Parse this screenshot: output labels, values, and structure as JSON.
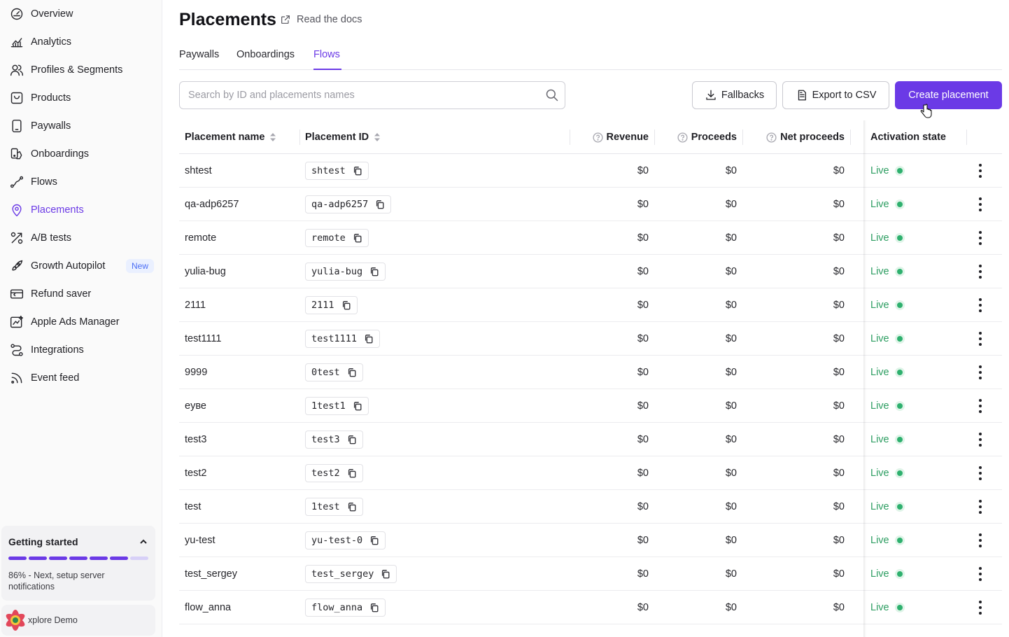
{
  "sidebar": {
    "items": [
      {
        "label": "Overview",
        "icon": "gauge-icon"
      },
      {
        "label": "Analytics",
        "icon": "chart-icon"
      },
      {
        "label": "Profiles & Segments",
        "icon": "users-icon"
      },
      {
        "label": "Products",
        "icon": "box-icon"
      },
      {
        "label": "Paywalls",
        "icon": "phone-icon"
      },
      {
        "label": "Onboardings",
        "icon": "onboarding-icon"
      },
      {
        "label": "Flows",
        "icon": "flow-icon"
      },
      {
        "label": "Placements",
        "icon": "pin-icon",
        "active": true
      },
      {
        "label": "A/B tests",
        "icon": "split-icon"
      },
      {
        "label": "Growth Autopilot",
        "icon": "rocket-icon",
        "badge": "New"
      },
      {
        "label": "Refund saver",
        "icon": "refund-icon"
      },
      {
        "label": "Apple Ads Manager",
        "icon": "ads-icon"
      },
      {
        "label": "Integrations",
        "icon": "integrations-icon"
      },
      {
        "label": "Event feed",
        "icon": "rss-icon"
      }
    ],
    "getting_started": {
      "title": "Getting started",
      "progress_segments_total": 7,
      "progress_segments_done": 6,
      "text": "86% - Next, setup server notifications"
    },
    "demo": {
      "label": "xplore Demo"
    }
  },
  "header": {
    "title": "Placements",
    "docs_link": "Read the docs"
  },
  "tabs": [
    {
      "label": "Paywalls"
    },
    {
      "label": "Onboardings"
    },
    {
      "label": "Flows",
      "active": true
    }
  ],
  "toolbar": {
    "search_placeholder": "Search by ID and placements names",
    "fallbacks_label": "Fallbacks",
    "export_label": "Export to CSV",
    "create_label": "Create placement"
  },
  "table": {
    "columns": {
      "name": "Placement name",
      "id": "Placement ID",
      "revenue": "Revenue",
      "proceeds": "Proceeds",
      "net_proceeds": "Net proceeds",
      "activation": "Activation state"
    },
    "rows": [
      {
        "name": "shtest",
        "id": "shtest",
        "revenue": "$0",
        "proceeds": "$0",
        "net": "$0",
        "state": "Live"
      },
      {
        "name": "qa-adp6257",
        "id": "qa-adp6257",
        "revenue": "$0",
        "proceeds": "$0",
        "net": "$0",
        "state": "Live"
      },
      {
        "name": "remote",
        "id": "remote",
        "revenue": "$0",
        "proceeds": "$0",
        "net": "$0",
        "state": "Live"
      },
      {
        "name": "yulia-bug",
        "id": "yulia-bug",
        "revenue": "$0",
        "proceeds": "$0",
        "net": "$0",
        "state": "Live"
      },
      {
        "name": "2111",
        "id": "2111",
        "revenue": "$0",
        "proceeds": "$0",
        "net": "$0",
        "state": "Live"
      },
      {
        "name": "test1111",
        "id": "test1111",
        "revenue": "$0",
        "proceeds": "$0",
        "net": "$0",
        "state": "Live"
      },
      {
        "name": "9999",
        "id": "0test",
        "revenue": "$0",
        "proceeds": "$0",
        "net": "$0",
        "state": "Live"
      },
      {
        "name": "eyве",
        "id": "1test1",
        "revenue": "$0",
        "proceeds": "$0",
        "net": "$0",
        "state": "Live"
      },
      {
        "name": "test3",
        "id": "test3",
        "revenue": "$0",
        "proceeds": "$0",
        "net": "$0",
        "state": "Live"
      },
      {
        "name": "test2",
        "id": "test2",
        "revenue": "$0",
        "proceeds": "$0",
        "net": "$0",
        "state": "Live"
      },
      {
        "name": "test",
        "id": "1test",
        "revenue": "$0",
        "proceeds": "$0",
        "net": "$0",
        "state": "Live"
      },
      {
        "name": "yu-test",
        "id": "yu-test-0",
        "revenue": "$0",
        "proceeds": "$0",
        "net": "$0",
        "state": "Live"
      },
      {
        "name": "test_sergey",
        "id": "test_sergey",
        "revenue": "$0",
        "proceeds": "$0",
        "net": "$0",
        "state": "Live"
      },
      {
        "name": "flow_anna",
        "id": "flow_anna",
        "revenue": "$0",
        "proceeds": "$0",
        "net": "$0",
        "state": "Live"
      }
    ]
  },
  "colors": {
    "accent": "#6b3ae6",
    "live": "#2e9e62"
  }
}
